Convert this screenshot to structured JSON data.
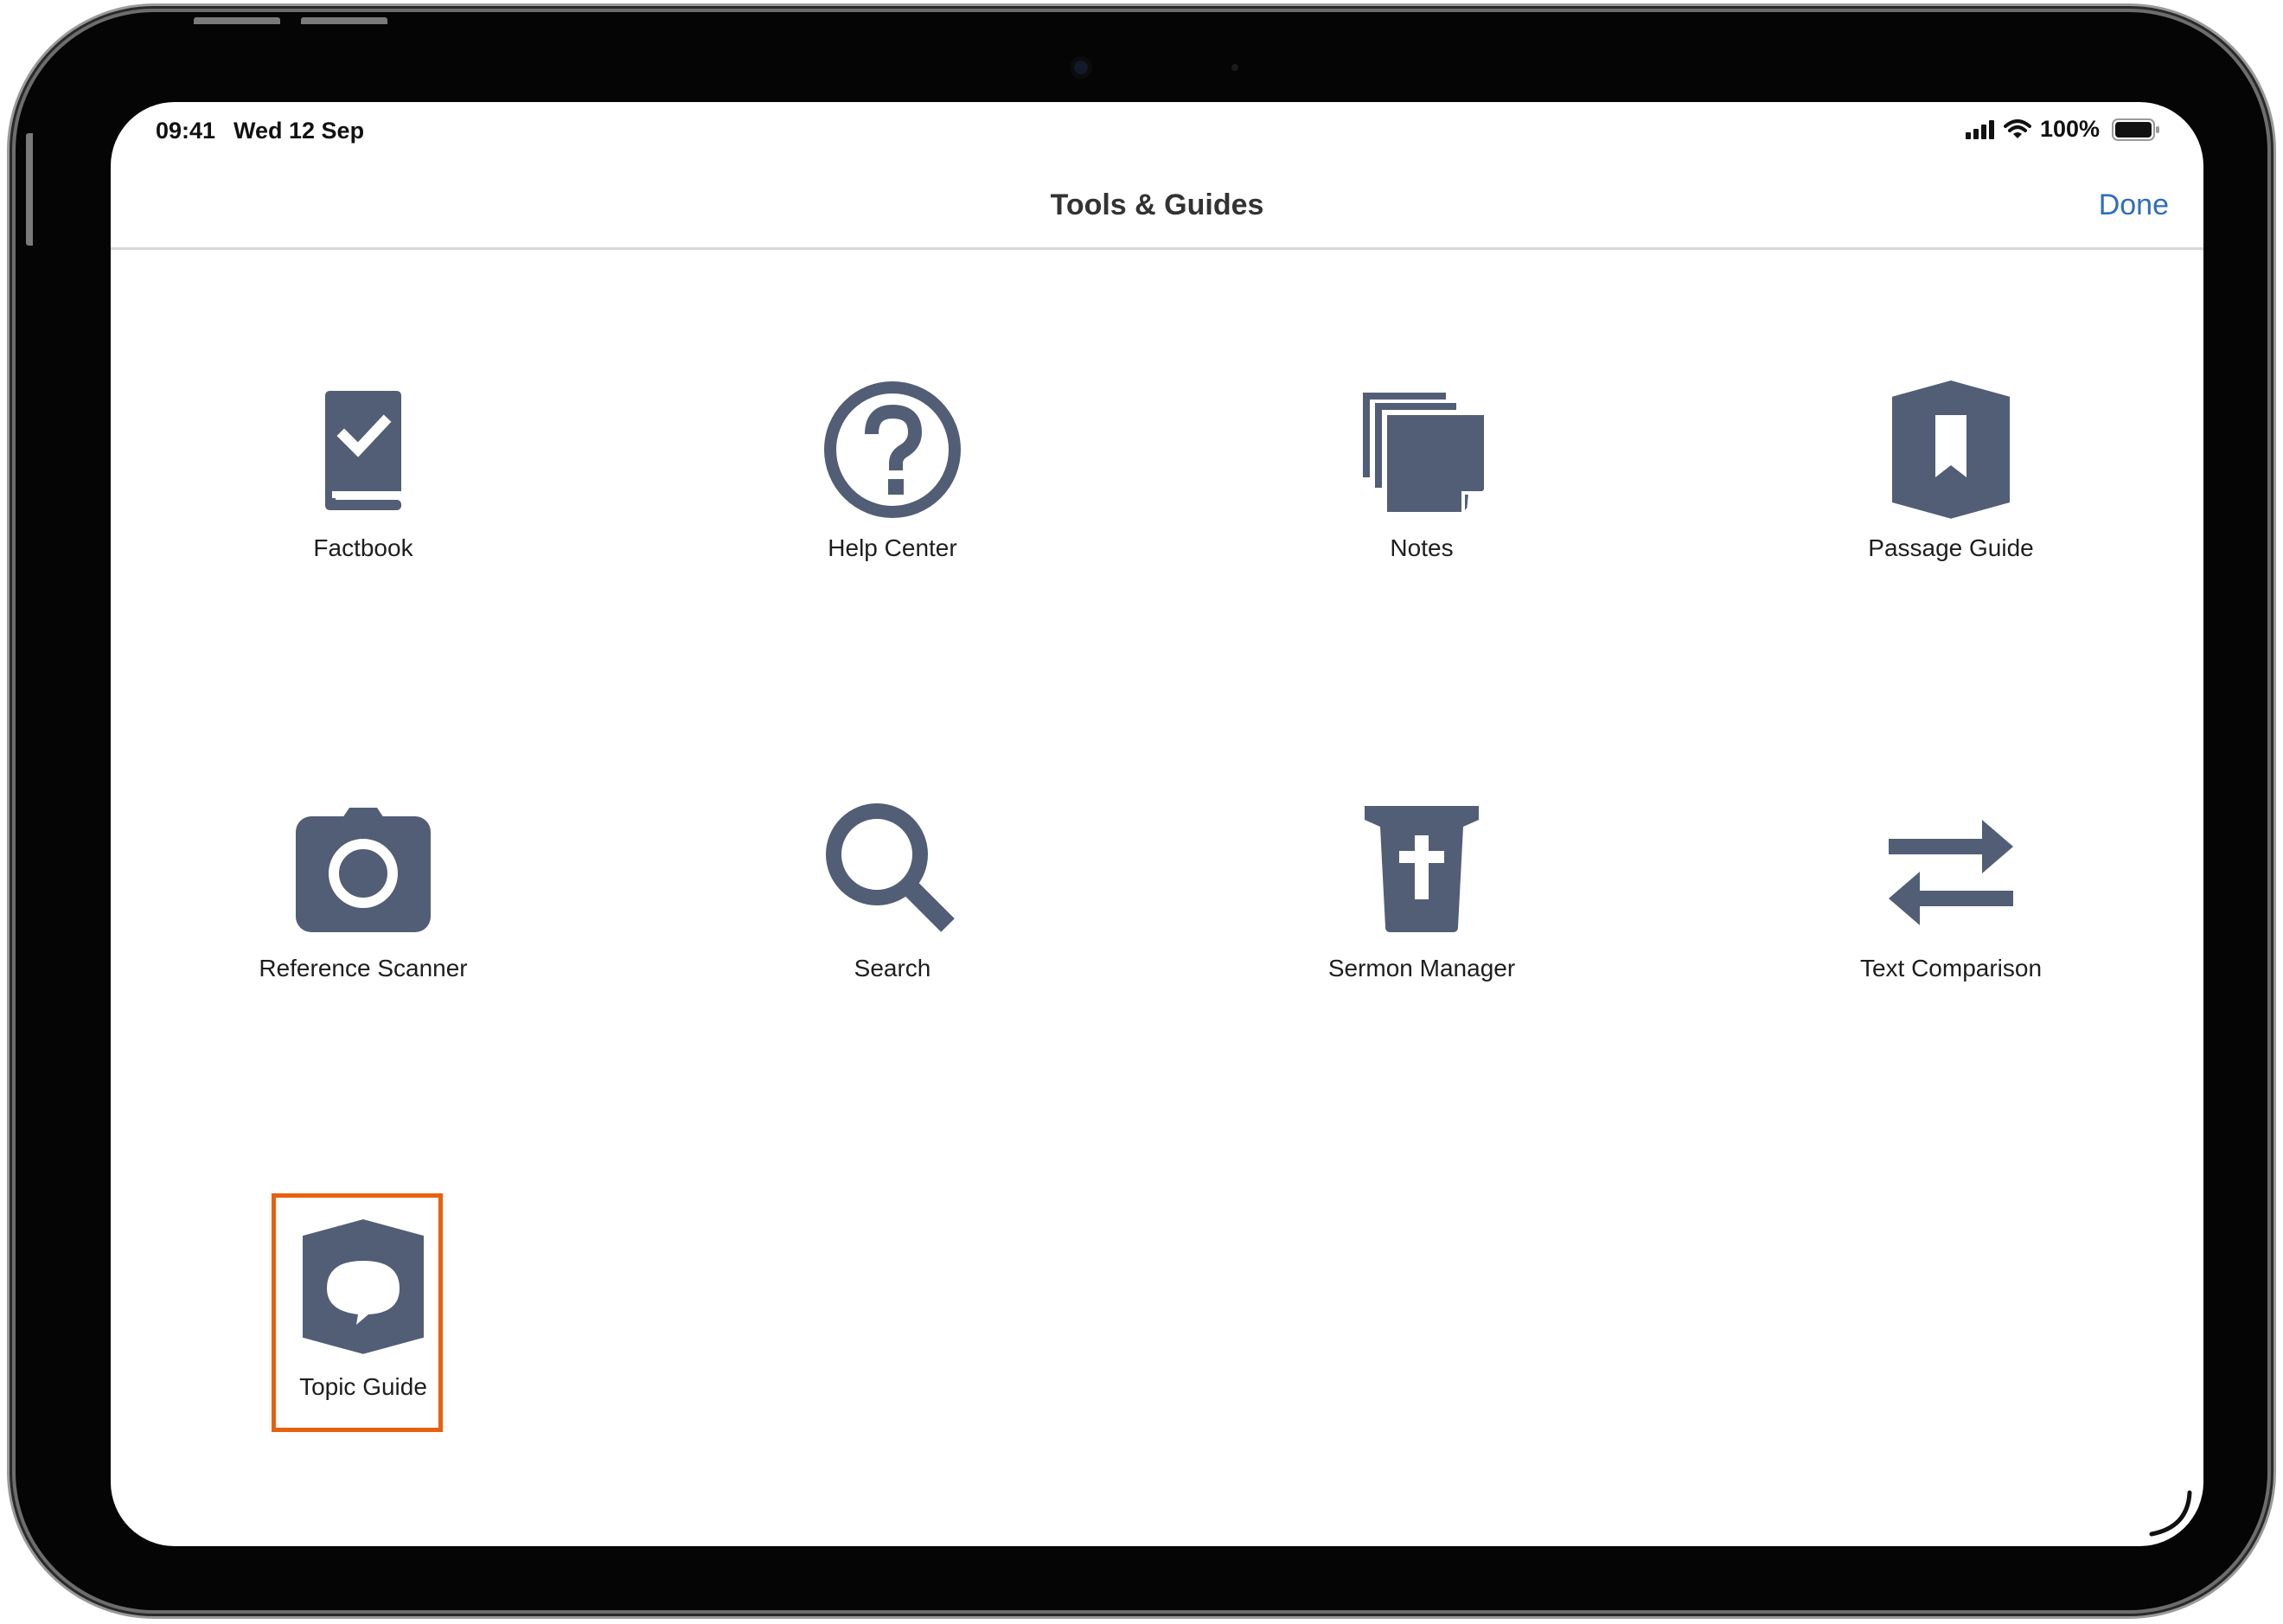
{
  "status_bar": {
    "time": "09:41",
    "date": "Wed 12 Sep",
    "battery": "100%"
  },
  "header": {
    "title": "Tools & Guides",
    "done_label": "Done"
  },
  "tools": [
    {
      "label": "Factbook",
      "icon": "factbook-icon"
    },
    {
      "label": "Help Center",
      "icon": "help-icon"
    },
    {
      "label": "Notes",
      "icon": "notes-icon"
    },
    {
      "label": "Passage Guide",
      "icon": "passage-guide-icon"
    },
    {
      "label": "Reference Scanner",
      "icon": "camera-icon"
    },
    {
      "label": "Search",
      "icon": "search-icon"
    },
    {
      "label": "Sermon Manager",
      "icon": "sermon-manager-icon"
    },
    {
      "label": "Text Comparison",
      "icon": "text-comparison-icon"
    },
    {
      "label": "Topic Guide",
      "icon": "topic-guide-icon"
    }
  ],
  "highlighted_tool": "Topic Guide",
  "colors": {
    "icon": "#525e76",
    "accent": "#2f6dbf",
    "highlight": "#e8600e"
  }
}
